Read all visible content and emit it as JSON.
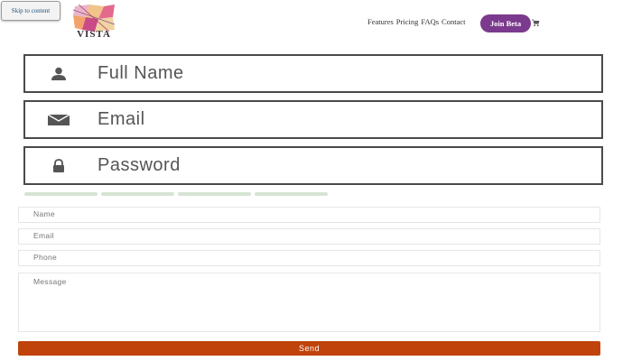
{
  "skip_link": {
    "label": "Skip to content"
  },
  "logo": {
    "name": "VISTA",
    "tagline": ""
  },
  "nav": {
    "items": [
      {
        "label": "Features"
      },
      {
        "label": "Pricing"
      },
      {
        "label": "FAQs"
      },
      {
        "label": "Contact"
      }
    ],
    "join_label": "Join Beta",
    "cart_icon": "cart-icon"
  },
  "signup": {
    "fields": [
      {
        "icon": "user-icon",
        "placeholder": "Full Name"
      },
      {
        "icon": "envelope-icon",
        "placeholder": "Email"
      },
      {
        "icon": "lock-icon",
        "placeholder": "Password"
      }
    ],
    "progress_segments": 4
  },
  "contact_form": {
    "name_placeholder": "Name",
    "email_placeholder": "Email",
    "phone_placeholder": "Phone",
    "message_placeholder": "Message",
    "send_label": "Send"
  },
  "colors": {
    "accent": "#7b3a8d",
    "send": "#c0430c",
    "progress": "#d6e4d3"
  }
}
